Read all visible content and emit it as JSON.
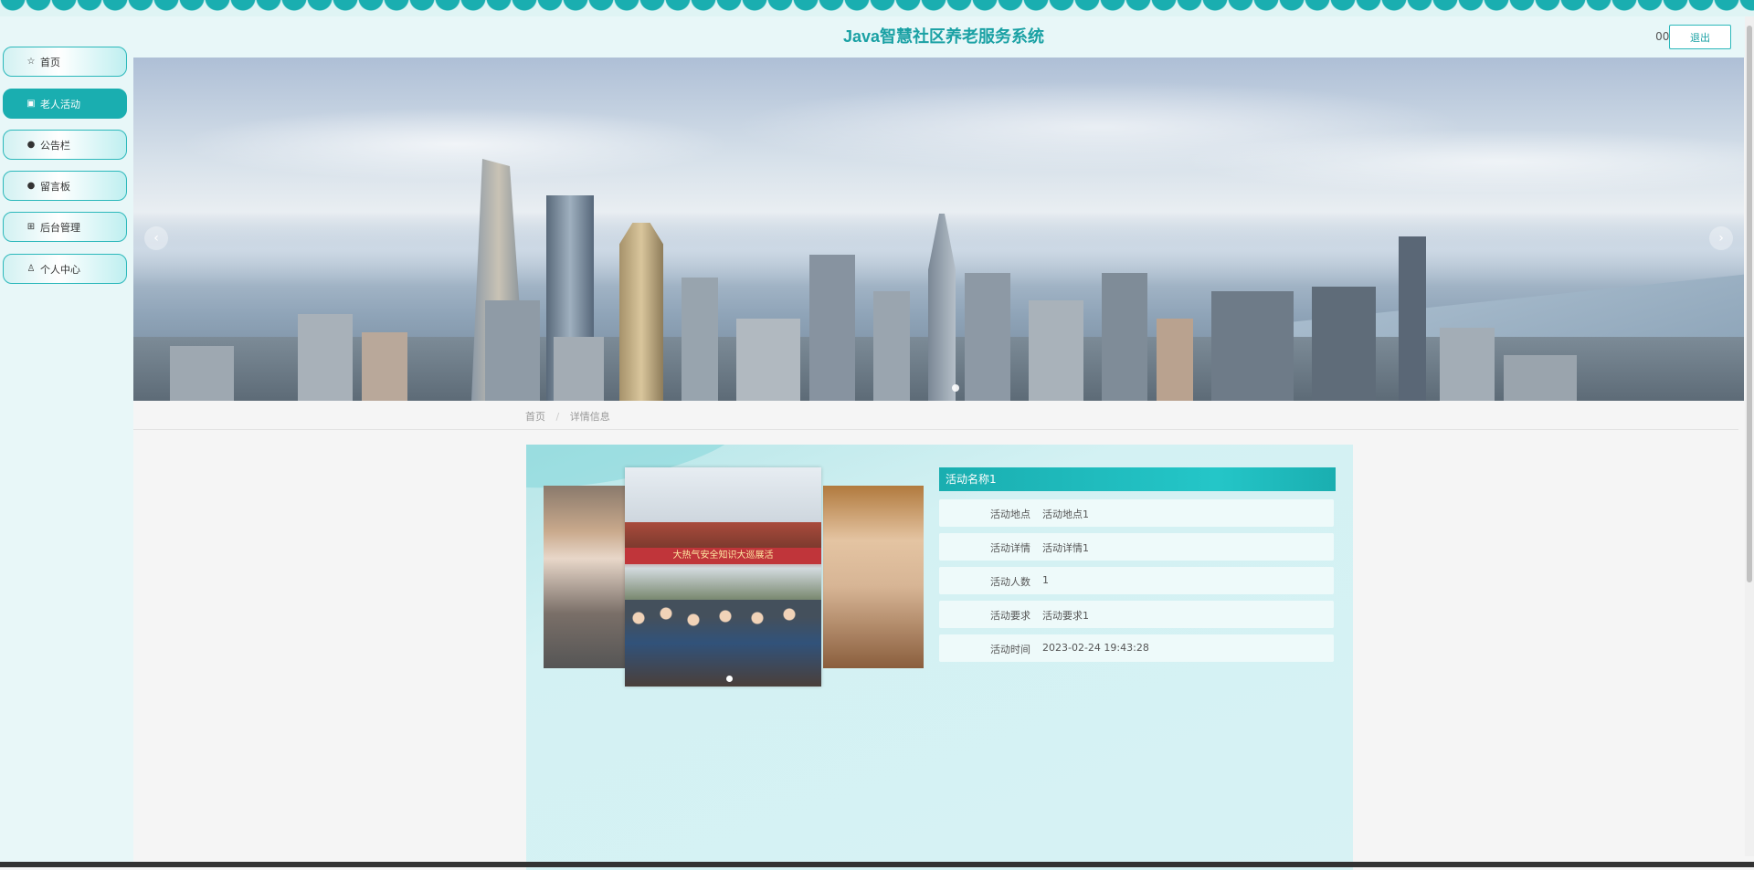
{
  "app": {
    "title": "Java智慧社区养老服务系统",
    "user": "001",
    "logout_label": "退出"
  },
  "sidebar": {
    "items": [
      {
        "label": "首页",
        "icon": "star-icon",
        "active": false
      },
      {
        "label": "老人活动",
        "icon": "bag-icon",
        "active": true
      },
      {
        "label": "公告栏",
        "icon": "info-icon",
        "active": false
      },
      {
        "label": "留言板",
        "icon": "question-icon",
        "active": false
      },
      {
        "label": "后台管理",
        "icon": "settings-icon",
        "active": false
      },
      {
        "label": "个人中心",
        "icon": "user-icon",
        "active": false
      }
    ]
  },
  "banner": {
    "prev_icon": "‹",
    "next_icon": "›"
  },
  "breadcrumb": {
    "home": "首页",
    "separator": "/",
    "current": "详情信息"
  },
  "detail": {
    "photo_banner_text": "大热气安全知识大巡展活",
    "title": "活动名称1",
    "rows": [
      {
        "label": "活动地点",
        "value": "活动地点1"
      },
      {
        "label": "活动详情",
        "value": "活动详情1"
      },
      {
        "label": "活动人数",
        "value": "1"
      },
      {
        "label": "活动要求",
        "value": "活动要求1"
      },
      {
        "label": "活动时间",
        "value": "2023-02-24 19:43:28"
      }
    ]
  },
  "colors": {
    "accent": "#1aaeb0",
    "title": "#1aa1a4",
    "panel": "#d3f1f3"
  }
}
